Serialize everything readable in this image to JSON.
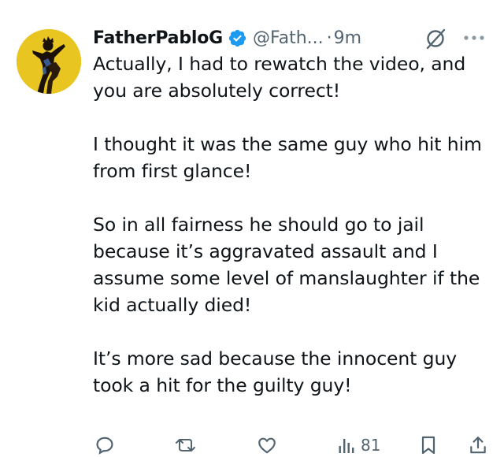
{
  "tweet": {
    "display_name": "FatherPabloG",
    "handle": "@Fath...",
    "separator": "·",
    "time": "9m",
    "paragraphs": [
      "Actually, I had to rewatch the video, and you are absolutely correct!",
      "I thought it was the same guy who hit him from first glance!",
      "So in all fairness he should go to jail because it’s aggravated assault and I assume some level of manslaughter if the kid actually died!",
      "It’s more sad because the innocent guy took a hit for the guilty guy!"
    ]
  },
  "actions": {
    "views": "81"
  },
  "icons": {
    "verified": "verified-badge-icon",
    "grok": "grok-icon",
    "more": "more-options-icon",
    "reply": "reply-icon",
    "retweet": "retweet-icon",
    "like": "like-icon",
    "views": "views-icon",
    "bookmark": "bookmark-icon",
    "share": "share-icon"
  },
  "colors": {
    "text": "#0f1419",
    "secondary": "#536471",
    "verified": "#1d9bf0",
    "avatar_bg": "#e7c31f"
  }
}
